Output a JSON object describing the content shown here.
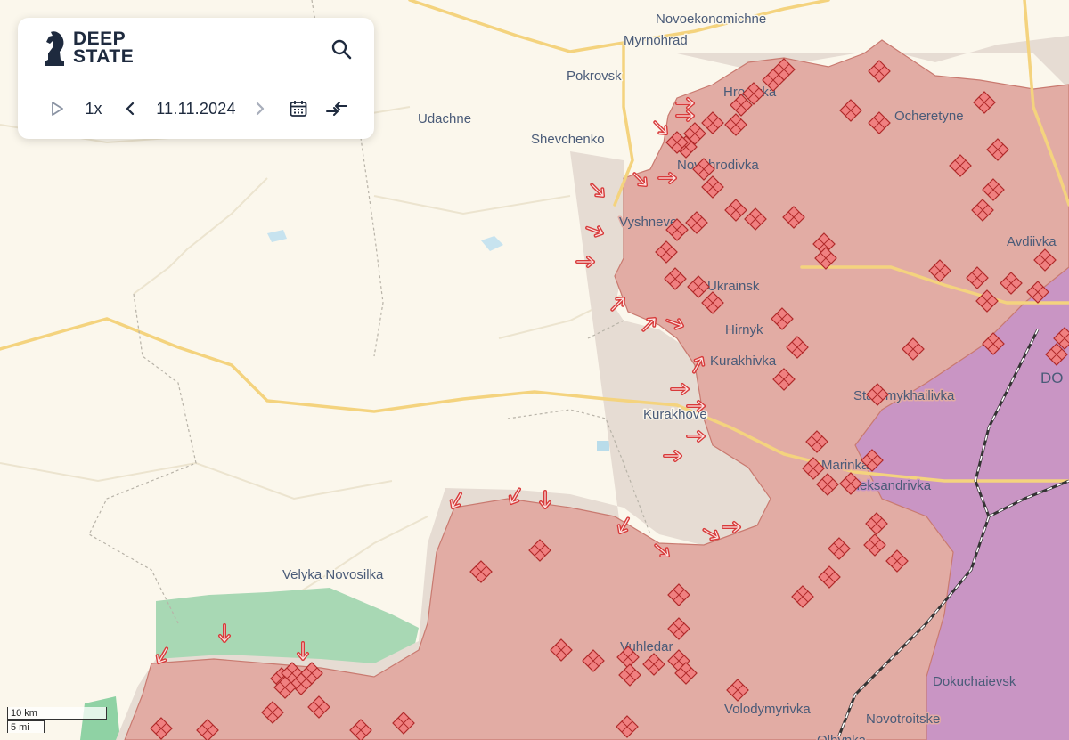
{
  "app": {
    "logo_line1": "DEEP",
    "logo_line2": "STATE"
  },
  "controls": {
    "play_icon": "play-icon",
    "speed": "1x",
    "prev_icon": "chevron-left-icon",
    "date": "11.11.2024",
    "next_icon": "chevron-right-icon",
    "calendar_icon": "calendar-icon",
    "compare_icon": "compare-arrows-icon",
    "search_icon": "search-icon"
  },
  "colors": {
    "background": "#fbf7ec",
    "occupied": "#e2aca4",
    "occupied_border": "#c97a70",
    "crimea_orlo": "#c995c4",
    "liberated": "#a8d8b4",
    "contested": "#e6dcd3",
    "road": "#f6d98a",
    "water": "#b9dcea",
    "marker": "#f08080",
    "marker_stroke": "#b02a2a"
  },
  "places": {
    "novoekonomichne": "Novoekonomichne",
    "myrnohrad": "Myrnohrad",
    "pokrovsk": "Pokrovsk",
    "udachne": "Udachne",
    "shevchenko": "Shevchenko",
    "hrodivka": "Hrodivka",
    "ocheretyne": "Ocheretyne",
    "novohrodivka": "Novohrodivka",
    "vyshneve": "Vyshneve",
    "avdiivka": "Avdiivka",
    "ukrainsk": "Ukrainsk",
    "hirnyk": "Hirnyk",
    "kurakhivka": "Kurakhivka",
    "staromykhailivka": "Staromykhailivka",
    "donetsk": "DO",
    "kurakhove": "Kurakhove",
    "marinka": "Marinka",
    "oleksandrivka": "Oleksandrivka",
    "velyka_novosilka": "Velyka Novosilka",
    "vuhledar": "Vuhledar",
    "dokuchaievsk": "Dokuchaievsk",
    "volodymyrivka": "Volodymyrivka",
    "novotroitske": "Novotroitske",
    "olhynka": "Olhynka"
  },
  "scale": {
    "metric": "10 km",
    "imperial": "5 mi"
  }
}
